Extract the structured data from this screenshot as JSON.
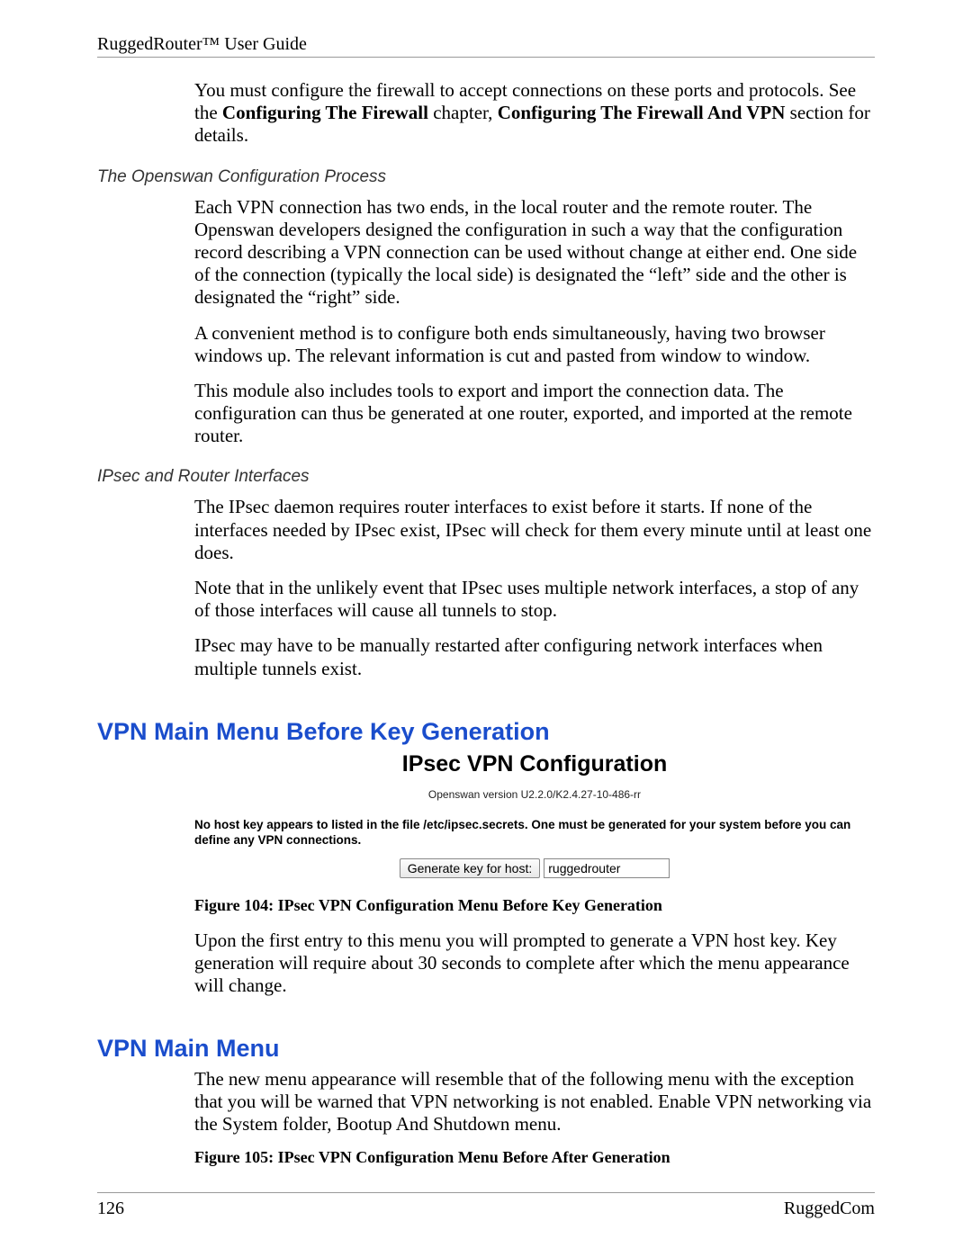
{
  "header": {
    "product": "RuggedRouter™ User Guide"
  },
  "intro": {
    "p1_prefix": "You must configure the firewall to accept connections on these ports and protocols. See the ",
    "p1_bold1": "Configuring The Firewall",
    "p1_mid": " chapter, ",
    "p1_bold2": "Configuring The Firewall And VPN",
    "p1_suffix": " section for details."
  },
  "sec_openswan": {
    "heading": "The Openswan Configuration Process",
    "p1": "Each VPN connection has two ends, in the local router and the remote router.  The Openswan developers designed the configuration in such a way that the configuration record describing a VPN connection can be used without change at either end.  One side of the connection (typically the local side) is designated the “left” side and the other is designated the “right” side.",
    "p2": "A convenient method is to configure both ends simultaneously, having two browser windows up.  The relevant information is cut and pasted from window to window.",
    "p3": "This module also includes tools to export and import the connection data. The configuration can thus be generated at one router, exported, and imported at the remote router."
  },
  "sec_ipsec": {
    "heading": "IPsec and Router Interfaces",
    "p1": "The IPsec daemon requires router interfaces to exist before it starts.  If none of the interfaces needed by IPsec exist, IPsec will check for them every minute until at least one does.",
    "p2": "Note that in the unlikely event that IPsec uses multiple network interfaces, a stop of any of those interfaces will cause all tunnels to stop.",
    "p3": "IPsec may have to be manually restarted after configuring network interfaces when multiple tunnels exist."
  },
  "sec_before": {
    "heading": "VPN Main Menu Before Key Generation",
    "figure": {
      "title": "IPsec VPN Configuration",
      "version": "Openswan version U2.2.0/K2.4.27-10-486-rr",
      "warning": "No host key appears to listed in the file /etc/ipsec.secrets. One must be generated for your system before you can define any VPN connections.",
      "button_label": "Generate key for host:",
      "input_value": "ruggedrouter"
    },
    "caption": "Figure 104: IPsec VPN Configuration Menu Before Key Generation",
    "p1": "Upon the first entry to this menu you will prompted to generate a VPN host key.  Key generation will require about 30 seconds to complete after which the menu appearance will change."
  },
  "sec_main": {
    "heading": "VPN Main Menu",
    "p1": "The new menu appearance will resemble that of the following menu with the exception that you will be warned that VPN networking is not enabled.  Enable VPN networking via the System folder, Bootup And Shutdown menu.",
    "caption": "Figure 105: IPsec VPN Configuration Menu Before After Generation"
  },
  "footer": {
    "page": "126",
    "company": "RuggedCom"
  }
}
